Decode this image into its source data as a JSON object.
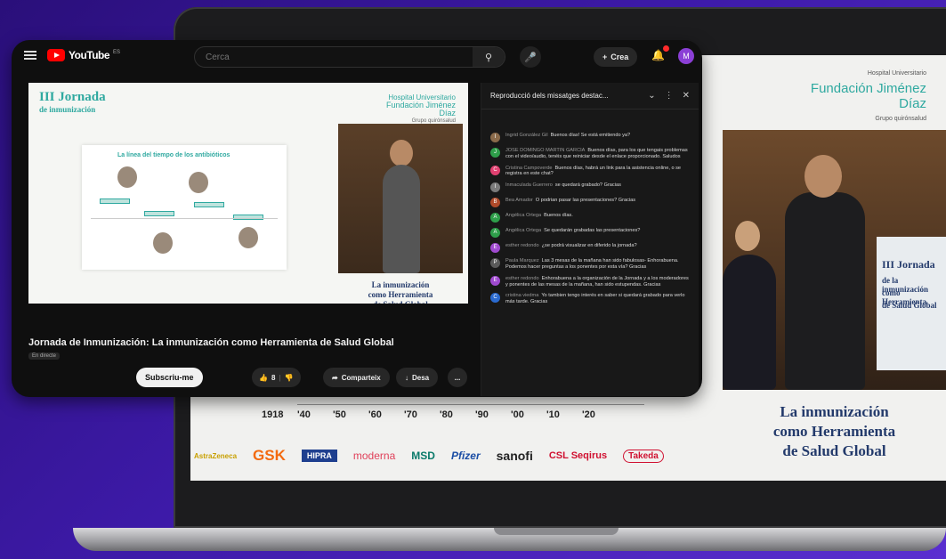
{
  "youtube": {
    "logo_text": "YouTube",
    "logo_country": "ES",
    "search_placeholder": "Cerca",
    "create_label": "Crea",
    "avatar_letter": "M",
    "video_title": "Jornada de Inmunización: La inmunización como Herramienta de Salud Global",
    "channel_chip": "En directe",
    "subscribe_label": "Subscriu-me",
    "likes_count": "8",
    "share_label": "Comparteix",
    "save_label": "Desa",
    "more_label": "..."
  },
  "slide": {
    "title_line1": "III Jornada",
    "title_line2": "de inmunización",
    "logo_small": "Hospital Universitario",
    "logo_name": "Fundación Jiménez Díaz",
    "logo_grupo": "Grupo quirónsalud",
    "card_title": "La línea del tiempo de los antibióticos",
    "caption_line1": "La inmunización",
    "caption_line2": "como Herramienta",
    "caption_line3": "de Salud Global",
    "banner_line1": "III Jornada",
    "banner_line2": "de la inmunización",
    "banner_line3": "como Herramienta",
    "banner_line4": "de Salud Global"
  },
  "timeline_years": [
    "1918",
    "'40",
    "'50",
    "'60",
    "'70",
    "'80",
    "'90",
    "'00",
    "'10",
    "'20"
  ],
  "sponsors": [
    "AstraZeneca",
    "GSK",
    "HIPRA",
    "moderna",
    "MSD",
    "Pfizer",
    "sanofi",
    "CSL Seqirus",
    "Takeda"
  ],
  "chat": {
    "header": "Reproducció dels missatges destac...",
    "messages": [
      {
        "author": "Ingrid González Gil",
        "text": "Buenos días! Se está emitiendo ya?",
        "color": "#8a6a4a"
      },
      {
        "author": "JOSE DOMINGO MARTIN GARCIA",
        "text": "Buenos días, para los que tengais problemas con el video/audio, tenéis que reiniciar desde el enlace proporcionado. Saludos",
        "color": "#2e9e4a"
      },
      {
        "author": "Cristina Campoverde",
        "text": "Buenos días, habrá un link para la asistencia online, o se registra en este chat?",
        "color": "#e04070"
      },
      {
        "author": "Inmaculada Guerrero",
        "text": "se quedará grabado? Gracias",
        "color": "#7a7a7a"
      },
      {
        "author": "Bea Amador",
        "text": "O podrian pasar las presentaciones? Gracias",
        "color": "#b04a2a"
      },
      {
        "author": "Angélica Ortega",
        "text": "Buenos días.",
        "color": "#2e9e4a"
      },
      {
        "author": "Angélica Ortega",
        "text": "Se quedarán grabadas las presentaciones?",
        "color": "#2e9e4a"
      },
      {
        "author": "esther redondo",
        "text": "¿se podrá visualizar en diferido la jornada?",
        "color": "#a04ad0"
      },
      {
        "author": "Paula Marquez",
        "text": "Las 3 mesas de la mañana han sido fabulosas- Enhorabuena. Podemos hacer preguntas a los ponentes por esta vía? Gracias",
        "color": "#5a5a5a"
      },
      {
        "author": "esther redondo",
        "text": "Enhorabuena a la organización de la Jornada y a los moderadores y ponentes de las mesas de la mañana, han sido estupendas. Gracias",
        "color": "#a04ad0"
      },
      {
        "author": "cristina viedma",
        "text": "Yo tambien tengo interés en saber si quedará grabado para verlo más tarde. Gracias",
        "color": "#2a6ad0"
      }
    ]
  },
  "icons": {
    "menu": "hamburger-icon",
    "search": "search-icon",
    "mic": "mic-icon",
    "notifications": "bell-icon",
    "like": "thumbs-up-icon",
    "dislike": "thumbs-down-icon",
    "share": "share-icon",
    "save": "download-icon",
    "chat_menu": "more-vert-icon",
    "chat_close": "close-icon"
  },
  "colors": {
    "brand_teal": "#2fa9a0",
    "slide_navy": "#233a6b",
    "yt_red": "#ff0000",
    "bg_purple": "#3d1aa8"
  }
}
